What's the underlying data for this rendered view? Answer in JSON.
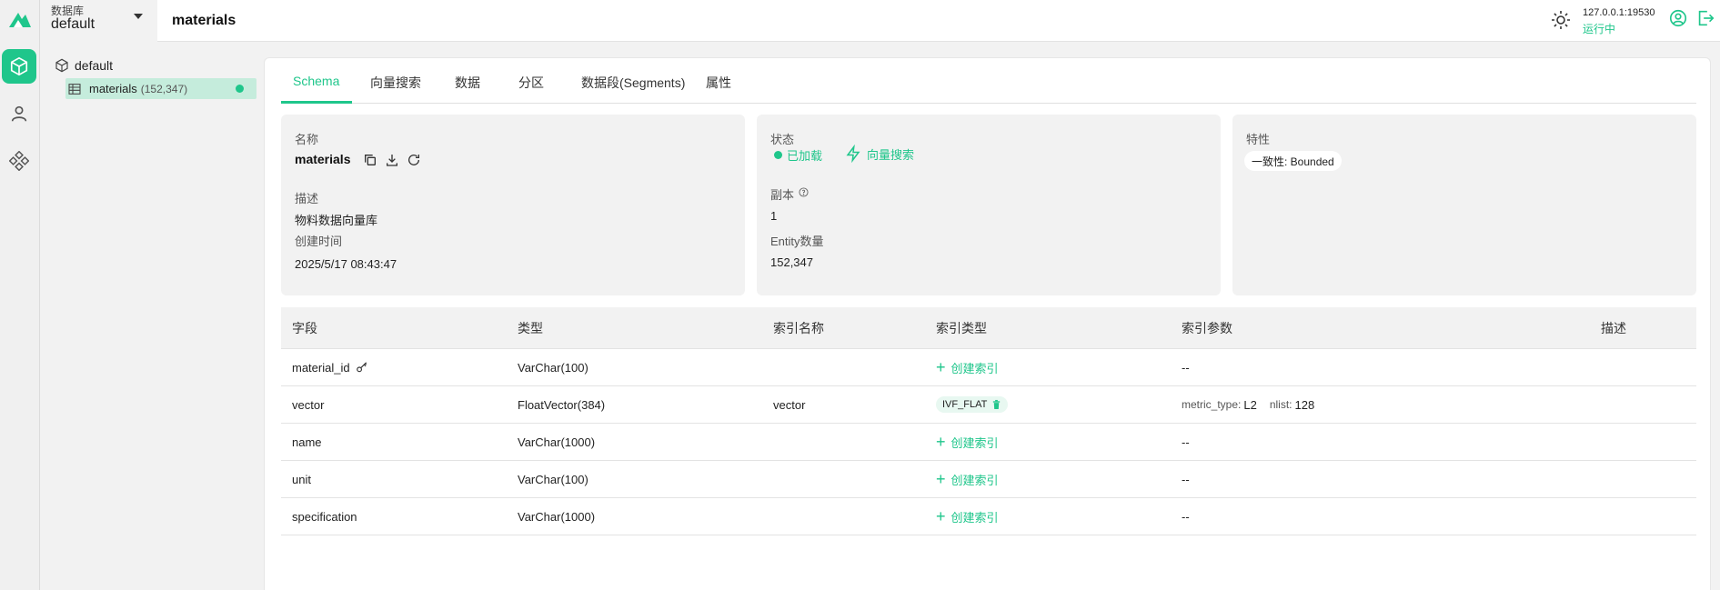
{
  "topbar": {
    "db_label": "数据库",
    "db_value": "default",
    "title": "materials",
    "address": "127.0.0.1:19530",
    "status": "运行中"
  },
  "tree": {
    "database": "default",
    "collection": {
      "name": "materials",
      "count": "(152,347)"
    }
  },
  "tabs": [
    "Schema",
    "向量搜索",
    "数据",
    "分区",
    "数据段(Segments)",
    "属性"
  ],
  "info": {
    "name_label": "名称",
    "name_value": "materials",
    "desc_label": "描述",
    "desc_value": "物料数据向量库",
    "created_label": "创建时间",
    "created_value": "2025/5/17 08:43:47",
    "status_label": "状态",
    "status_loaded": "已加载",
    "vector_search": "向量搜索",
    "replica_label": "副本",
    "replica_value": "1",
    "entity_label": "Entity数量",
    "entity_value": "152,347",
    "feature_label": "特性",
    "consistency": "一致性: Bounded"
  },
  "table": {
    "headers": [
      "字段",
      "类型",
      "索引名称",
      "索引类型",
      "索引参数",
      "描述"
    ],
    "create_index": "创建索引",
    "rows": [
      {
        "field": "material_id",
        "type": "VarChar(100)",
        "index_name": "",
        "params": "--"
      },
      {
        "field": "vector",
        "type": "FloatVector(384)",
        "index_name": "vector",
        "index_type": "IVF_FLAT",
        "params_list": [
          {
            "k": "metric_type:",
            "v": "L2"
          },
          {
            "k": "nlist:",
            "v": "128"
          }
        ]
      },
      {
        "field": "name",
        "type": "VarChar(1000)",
        "index_name": "",
        "params": "--"
      },
      {
        "field": "unit",
        "type": "VarChar(100)",
        "index_name": "",
        "params": "--"
      },
      {
        "field": "specification",
        "type": "VarChar(1000)",
        "index_name": "",
        "params": "--"
      }
    ]
  },
  "colors": {
    "accent": "#1fc68b",
    "tree_selected": "#c5ecdc",
    "card_bg": "#f2f2f2"
  },
  "icons": [
    "milvus-logo",
    "cube-icon",
    "user-icon",
    "system-icon",
    "sun-icon",
    "account-icon",
    "logout-icon",
    "copy-icon",
    "download-icon",
    "refresh-icon",
    "lightning-icon",
    "help-icon",
    "key-icon",
    "trash-icon",
    "plus-icon",
    "table-icon"
  ]
}
